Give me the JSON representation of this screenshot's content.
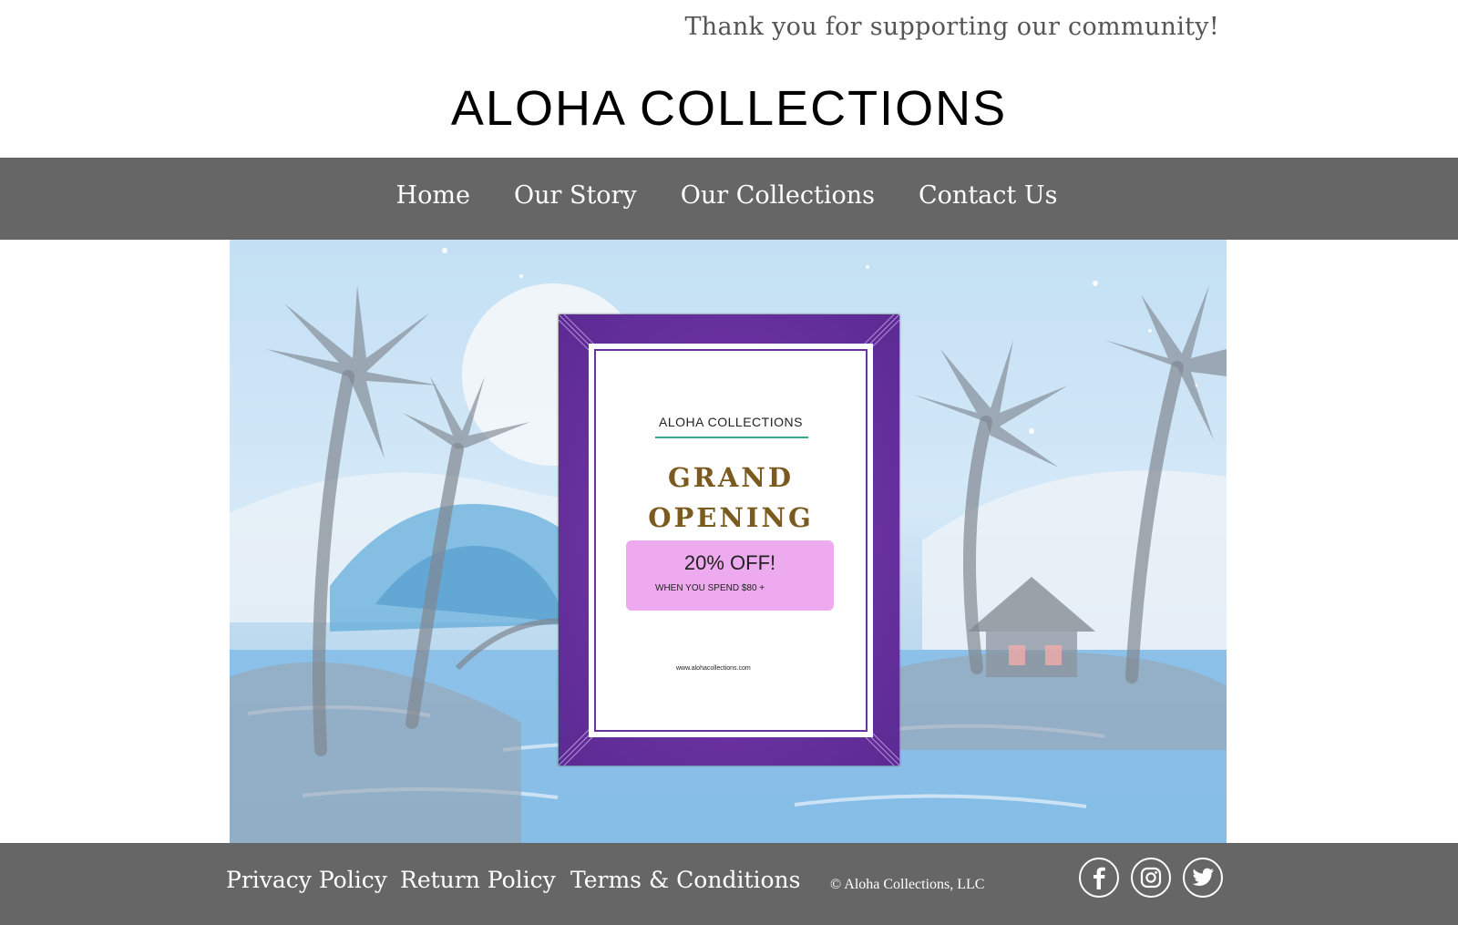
{
  "header": {
    "tagline": "Thank you for supporting our community!",
    "site_title": "ALOHA COLLECTIONS"
  },
  "nav": {
    "items": [
      {
        "label": "Home"
      },
      {
        "label": "Our Story"
      },
      {
        "label": "Our Collections"
      },
      {
        "label": "Contact Us"
      }
    ]
  },
  "hero": {
    "flyer": {
      "brand": "ALOHA COLLECTIONS",
      "headline_line1": "GRAND",
      "headline_line2": "OPENING",
      "offer_title": "20% OFF!",
      "offer_sub": "WHEN YOU SPEND $80 +",
      "url": "www.alohacollections.com"
    }
  },
  "footer": {
    "links": [
      {
        "label": "Privacy Policy"
      },
      {
        "label": "Return Policy"
      },
      {
        "label": "Terms & Conditions"
      }
    ],
    "copyright": "© Aloha Collections, LLC",
    "social": [
      {
        "icon": "facebook-icon"
      },
      {
        "icon": "instagram-icon"
      },
      {
        "icon": "twitter-icon"
      }
    ]
  },
  "colors": {
    "bar": "#666666",
    "flyer_purple": "#6a32a0",
    "offer_pink": "#eeaaee",
    "accent_teal": "#3aa98f",
    "headline_gold": "#7a5a1e"
  }
}
